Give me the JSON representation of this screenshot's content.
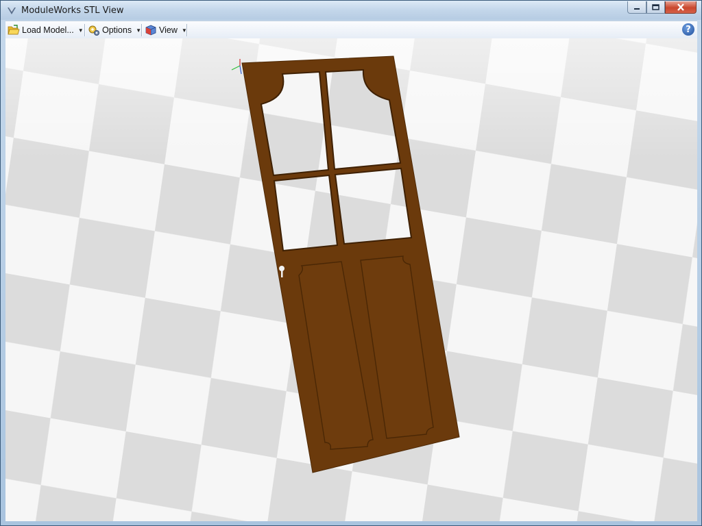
{
  "window": {
    "title": "ModuleWorks STL View",
    "title_icon": "app-logo-icon",
    "controls": {
      "minimize": "minimize-icon",
      "maximize": "maximize-icon",
      "close": "close-icon"
    }
  },
  "toolbar": {
    "load_model_label": "Load Model...",
    "load_model_icon": "folder-open-icon",
    "options_label": "Options",
    "options_icon": "gears-icon",
    "view_label": "View",
    "view_icon": "cube-icon",
    "help_label": "?"
  },
  "viewport": {
    "model": "door",
    "colors": {
      "door": "#6b3a0c",
      "checker_light": "#f6f6f6",
      "checker_dark": "#dedede"
    }
  }
}
